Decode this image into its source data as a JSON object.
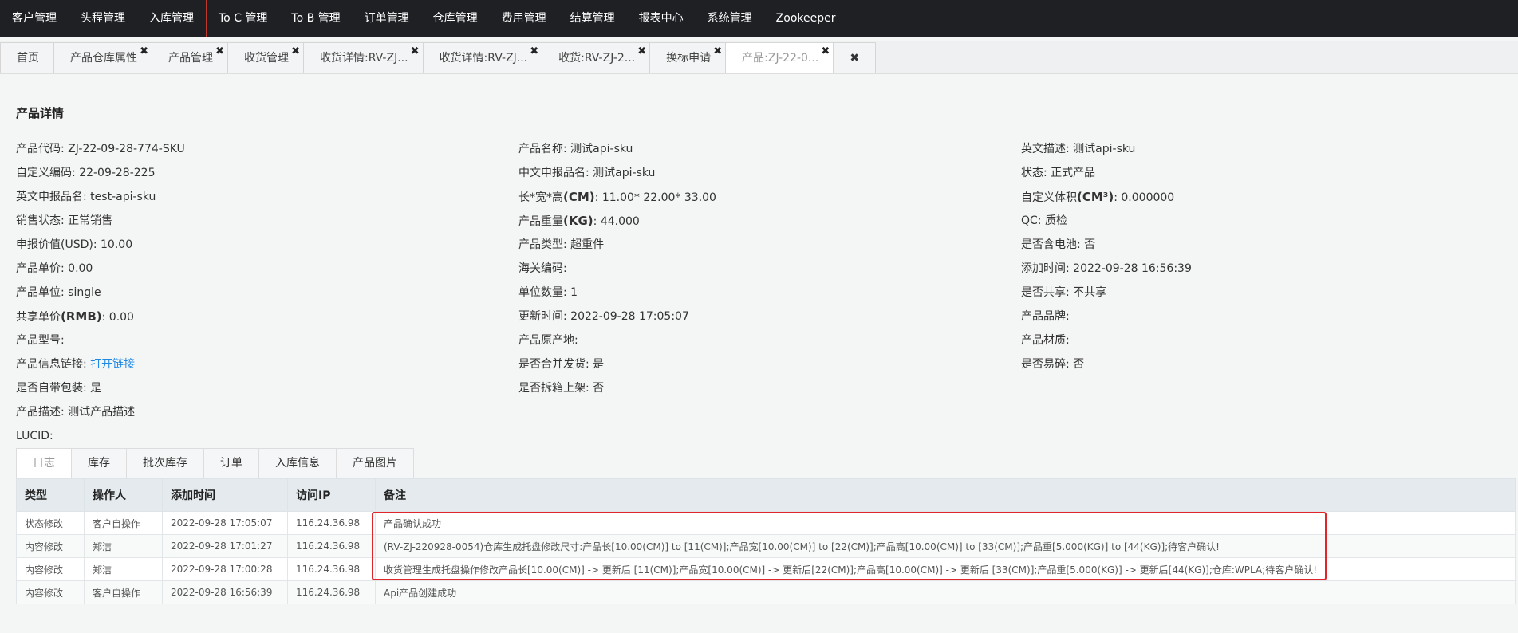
{
  "topnav": [
    "客户管理",
    "头程管理",
    "入库管理",
    "To C 管理",
    "To B 管理",
    "订单管理",
    "仓库管理",
    "费用管理",
    "结算管理",
    "报表中心",
    "系统管理",
    "Zookeeper"
  ],
  "tabs": [
    {
      "label": "首页",
      "closable": false
    },
    {
      "label": "产品仓库属性",
      "closable": true
    },
    {
      "label": "产品管理",
      "closable": true
    },
    {
      "label": "收货管理",
      "closable": true
    },
    {
      "label": "收货详情:RV-ZJ...",
      "closable": true
    },
    {
      "label": "收货详情:RV-ZJ...",
      "closable": true
    },
    {
      "label": "收货:RV-ZJ-2...",
      "closable": true
    },
    {
      "label": "换标申请",
      "closable": true
    },
    {
      "label": "产品:ZJ-22-0...",
      "closable": true,
      "active": true
    }
  ],
  "close_icon": "✖",
  "section_title": "产品详情",
  "details": {
    "col1": [
      {
        "label": "产品代码: ",
        "value": "ZJ-22-09-28-774-SKU"
      },
      {
        "label": "自定义编码: ",
        "value": "22-09-28-225"
      },
      {
        "label": "英文申报品名: ",
        "value": "test-api-sku"
      },
      {
        "label": "销售状态: ",
        "value": "正常销售"
      },
      {
        "label": "申报价值(USD): ",
        "value": "10.00"
      },
      {
        "label": "产品单价: ",
        "value": "0.00"
      },
      {
        "label": "产品单位: ",
        "value": "single"
      },
      {
        "label": "共享单价(RMB): ",
        "value": "0.00"
      },
      {
        "label": "产品型号: ",
        "value": ""
      },
      {
        "label": "产品信息链接: ",
        "value": "打开链接",
        "link": true
      },
      {
        "label": "是否自带包装:  ",
        "value": "是"
      },
      {
        "label": "产品描述: ",
        "value": "测试产品描述"
      },
      {
        "label": "LUCID: ",
        "value": ""
      }
    ],
    "col2": [
      {
        "label": "产品名称: ",
        "value": "测试api-sku"
      },
      {
        "label": "中文申报品名: ",
        "value": "测试api-sku"
      },
      {
        "label": "长*宽*高(CM):  ",
        "value": "11.00* 22.00* 33.00"
      },
      {
        "label": "产品重量(KG): ",
        "value": "44.000"
      },
      {
        "label": "产品类型: ",
        "value": "超重件"
      },
      {
        "label": "海关编码: ",
        "value": ""
      },
      {
        "label": "单位数量: ",
        "value": "1"
      },
      {
        "label": "更新时间: ",
        "value": "2022-09-28 17:05:07"
      },
      {
        "label": "产品原产地: ",
        "value": ""
      },
      {
        "label": "是否合并发货:  ",
        "value": "是"
      },
      {
        "label": "是否拆箱上架:  ",
        "value": "否"
      }
    ],
    "col3": [
      {
        "label": "英文描述: ",
        "value": "测试api-sku"
      },
      {
        "label": "状态: ",
        "value": "正式产品"
      },
      {
        "label": "自定义体积(CM³): ",
        "value": "0.000000"
      },
      {
        "label": "QC:  ",
        "value": "质检"
      },
      {
        "label": "是否含电池: ",
        "value": "否"
      },
      {
        "label": "添加时间: ",
        "value": "2022-09-28 16:56:39"
      },
      {
        "label": "是否共享: ",
        "value": "不共享"
      },
      {
        "label": "产品品牌: ",
        "value": ""
      },
      {
        "label": "产品材质: ",
        "value": ""
      },
      {
        "label": "是否易碎:  ",
        "value": "否"
      }
    ]
  },
  "detail_tabs": [
    "日志",
    "库存",
    "批次库存",
    "订单",
    "入库信息",
    "产品图片"
  ],
  "log_table": {
    "headers": [
      "类型",
      "操作人",
      "添加时间",
      "访问IP",
      "备注"
    ],
    "rows": [
      [
        "状态修改",
        "客户自操作",
        "2022-09-28 17:05:07",
        "116.24.36.98",
        "产品确认成功"
      ],
      [
        "内容修改",
        "郑洁",
        "2022-09-28 17:01:27",
        "116.24.36.98",
        "(RV-ZJ-220928-0054)仓库生成托盘修改尺寸:产品长[10.00(CM)] to [11(CM)];产品宽[10.00(CM)] to [22(CM)];产品高[10.00(CM)] to [33(CM)];产品重[5.000(KG)] to [44(KG)];待客户确认!"
      ],
      [
        "内容修改",
        "郑洁",
        "2022-09-28 17:00:28",
        "116.24.36.98",
        "收货管理生成托盘操作修改产品长[10.00(CM)] -> 更新后 [11(CM)];产品宽[10.00(CM)] -> 更新后[22(CM)];产品高[10.00(CM)] -> 更新后 [33(CM)];产品重[5.000(KG)] -> 更新后[44(KG)];仓库:WPLA;待客户确认!"
      ],
      [
        "内容修改",
        "客户自操作",
        "2022-09-28 16:56:39",
        "116.24.36.98",
        "Api产品创建成功"
      ]
    ]
  },
  "colors": {
    "topnav_bg": "#1e2024",
    "link": "#1e88e5",
    "highlight": "#e0262b"
  }
}
